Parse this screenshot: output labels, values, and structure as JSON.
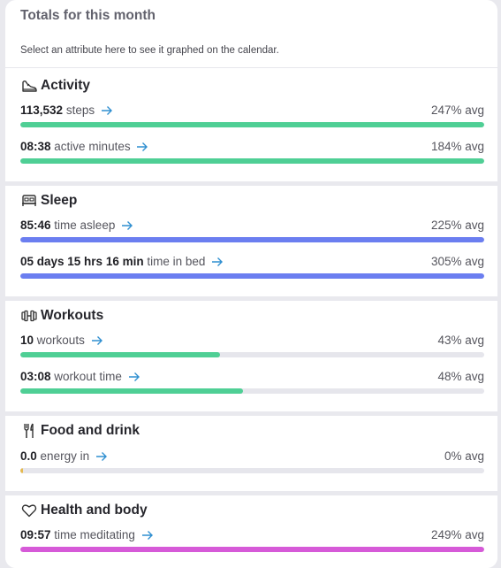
{
  "header": {
    "title": "Totals for this month",
    "subtitle": "Select an attribute here to see it graphed on the calendar."
  },
  "colors": {
    "activity": "#4fcf95",
    "sleep": "#6b7ef0",
    "workouts": "#4fcf95",
    "food": "#e5b94f",
    "health": "#d65ad8",
    "arrow": "#2f8fd0"
  },
  "sections": [
    {
      "title": "Activity",
      "icon": "sneaker-icon",
      "rows": [
        {
          "value": "113,532",
          "label": "steps",
          "avg": "247% avg",
          "fill": 1.0
        },
        {
          "value": "08:38",
          "label": "active minutes",
          "avg": "184% avg",
          "fill": 1.0
        }
      ]
    },
    {
      "title": "Sleep",
      "icon": "bed-icon",
      "rows": [
        {
          "value": "85:46",
          "label": "time asleep",
          "avg": "225% avg",
          "fill": 1.0
        },
        {
          "value": "05 days 15 hrs 16 min",
          "label": "time in bed",
          "avg": "305% avg",
          "fill": 1.0
        }
      ]
    },
    {
      "title": "Workouts",
      "icon": "dumbbell-icon",
      "rows": [
        {
          "value": "10",
          "label": "workouts",
          "avg": "43% avg",
          "fill": 0.43
        },
        {
          "value": "03:08",
          "label": "workout time",
          "avg": "48% avg",
          "fill": 0.48
        }
      ]
    },
    {
      "title": "Food and drink",
      "icon": "fork-knife-icon",
      "rows": [
        {
          "value": "0.0",
          "label": "energy in",
          "avg": "0% avg",
          "fill": 0.0
        }
      ]
    },
    {
      "title": "Health and body",
      "icon": "heart-icon",
      "rows": [
        {
          "value": "09:57",
          "label": "time meditating",
          "avg": "249% avg",
          "fill": 1.0
        }
      ]
    }
  ]
}
